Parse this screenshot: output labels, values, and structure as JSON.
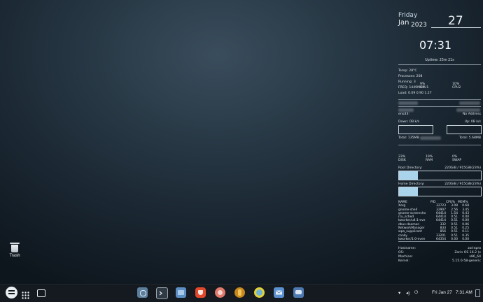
{
  "desktop": {
    "trash_label": "Trash"
  },
  "conky": {
    "day": "Friday",
    "month": "Jan",
    "year": "2023",
    "date": "27",
    "time": "07:31",
    "uptime": "Uptime: 25m 21s",
    "temp_label": "Temp:",
    "temp_value": "28°C",
    "processes_label": "Processes:",
    "processes_value": "208",
    "running_label": "Running:",
    "running_value": "3",
    "freq_label": "FREQ:",
    "freq_value": "1449MHz",
    "load_label": "Load:",
    "load_value": "0.09 0.90 1.27",
    "cpu1_pct": "9%",
    "cpu1_label": "CPU1",
    "cpu2_pct": "10%",
    "cpu2_label": "CPU2",
    "iface": "eno33:",
    "address": "No Address",
    "down_label": "Down: 0B  k/s",
    "up_label": "Up: 0B  k/s",
    "total_down": "Total: 135MB",
    "total_up": "Total: 5.68MB",
    "disk_pct": "23%",
    "disk_label": "DISK",
    "ram_pct": "19%",
    "ram_label": "RAM",
    "swap_pct": "0%",
    "swap_label": "SWAP",
    "root_label": "Root Directory:",
    "root_value": "220GiB / 915GiB(23%)",
    "root_fill": 0.23,
    "home_label": "Home Directory:",
    "home_value": "220GiB / 915GiB(23%)",
    "home_fill": 0.23,
    "proc_headers": [
      "NAME",
      "PID",
      "CPU%",
      "MEM%"
    ],
    "processes": [
      [
        "Xorg",
        "32723",
        "3.08",
        "0.68"
      ],
      [
        "gnome-shell",
        "32907",
        "2.56",
        "3.45"
      ],
      [
        "gnome-screensho",
        "64414",
        "1.54",
        "0.43"
      ],
      [
        "rcu_sched",
        "64414",
        "0.51",
        "0.00"
      ],
      [
        "kworker/u4:1-eve",
        "64414",
        "0.51",
        "0.00"
      ],
      [
        "dbus-daemon",
        "332",
        "0.51",
        "0.06"
      ],
      [
        "NetworkManager",
        "833",
        "0.51",
        "0.25"
      ],
      [
        "wpa_supplicant",
        "856",
        "0.51",
        "0.11"
      ],
      [
        "conky",
        "33201",
        "0.51",
        "0.35"
      ],
      [
        "kworker/1:0-even",
        "64354",
        "0.00",
        "0.00"
      ]
    ],
    "hostname_label": "Hostname:",
    "hostname_value": "zorinpro",
    "os_label": "OS:",
    "os_value": "Zorin OS 16.2 (x ",
    "machine_label": "Machine:",
    "machine_value": "x86_64",
    "kernel_label": "Kernel:",
    "kernel_value": "5.15.0-58-generic"
  },
  "taskbar": {
    "apps": [
      {
        "name": "zorin-menu-icon",
        "color": "#e8eef2"
      },
      {
        "name": "app-grid-icon",
        "color": "#e8eef2"
      },
      {
        "name": "workspace-icon",
        "color": "#e8eef2"
      },
      {
        "name": "software-icon",
        "color": "#5b7e9c"
      },
      {
        "name": "terminal-icon",
        "color": "#2f3a44"
      },
      {
        "name": "files-icon",
        "color": "#5d8fc4"
      },
      {
        "name": "brave-icon",
        "color": "#e0482c"
      },
      {
        "name": "app-icon",
        "color": "#e07a6a"
      },
      {
        "name": "app-icon-gold",
        "color": "#c8891e"
      },
      {
        "name": "app-icon-lime",
        "color": "#e2d13a"
      },
      {
        "name": "mail-icon",
        "color": "#5c91cf"
      },
      {
        "name": "chat-icon",
        "color": "#4e79b0"
      }
    ],
    "date": "Fri Jan 27",
    "time": "7:31 AM"
  }
}
